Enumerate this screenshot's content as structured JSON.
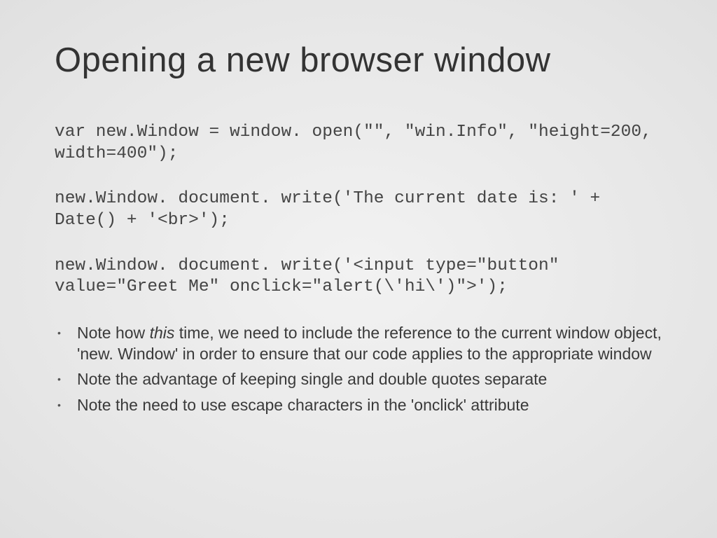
{
  "title": "Opening a new browser window",
  "code": {
    "block1": "var new.Window = window. open(\"\", \"win.Info\", \"height=200, width=400\");",
    "block2": "new.Window. document. write('The current date is: ' + Date() + '<br>');",
    "block3": "new.Window. document. write('<input type=\"button\"  value=\"Greet Me\" onclick=\"alert(\\'hi\\')\">');"
  },
  "bullets": {
    "b1_pre": "Note how ",
    "b1_em": "this",
    "b1_post": " time, we need to include the reference to the current window object, 'new. Window' in order to ensure that our code applies to the appropriate window",
    "b2": "Note the advantage of keeping single and double quotes separate",
    "b3": "Note the need to use escape characters in the 'onclick' attribute"
  }
}
